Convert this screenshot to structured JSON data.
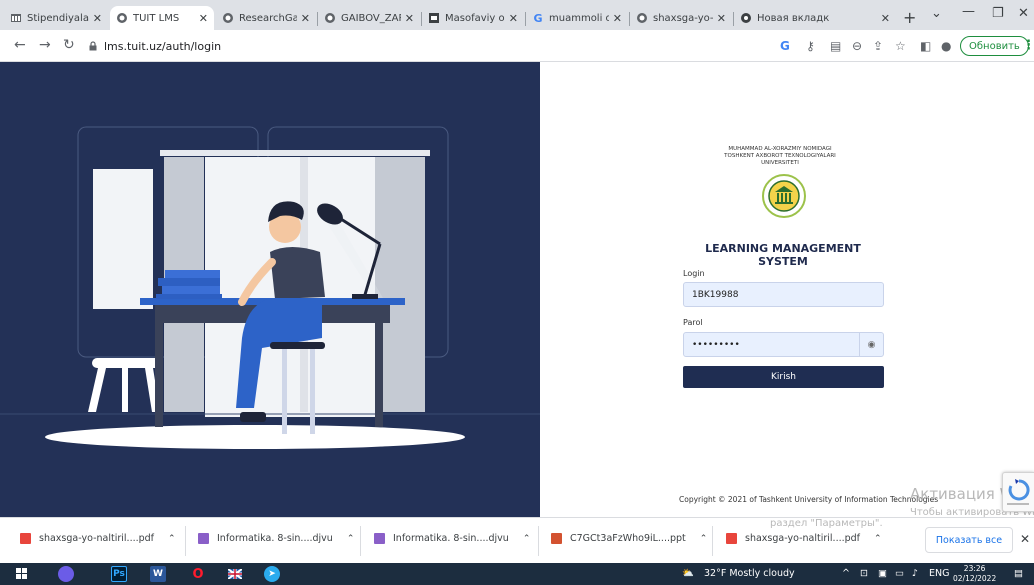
{
  "browser": {
    "tabs": [
      {
        "label": "Stipendiyalar",
        "icon": "bank-icon"
      },
      {
        "label": "TUIT LMS",
        "icon": "globe-icon"
      },
      {
        "label": "ResearchGate",
        "icon": "globe-icon"
      },
      {
        "label": "GAIBOV_ZAR",
        "icon": "globe-icon"
      },
      {
        "label": "Masofaviy o'z",
        "icon": "classroom-icon"
      },
      {
        "label": "muammoli o'",
        "icon": "google-icon"
      },
      {
        "label": "shaxsga-yo-n",
        "icon": "globe-icon"
      },
      {
        "label": "Новая вкладк",
        "icon": "chrome-icon"
      }
    ],
    "url": "lms.tuit.uz/auth/login",
    "update_label": "Обновить"
  },
  "login": {
    "university_lines": [
      "MUHAMMAD AL-XORAZMIY NOMIDAGI",
      "TOSHKENT AXBOROT TEXNOLOGIYALARI",
      "UNIVERSITETI"
    ],
    "title": "LEARNING MANAGEMENT SYSTEM",
    "login_label": "Login",
    "login_value": "1BK19988",
    "password_label": "Parol",
    "password_value": "•••••••••",
    "submit_label": "Kirish",
    "copyright": "Copyright © 2021 of Tashkent University of Information Technologies"
  },
  "watermark": {
    "line1": "Активация Windows",
    "line2": "Чтобы активировать Windows, перейдите в",
    "line3": "раздел \"Параметры\"."
  },
  "downloads": {
    "items": [
      {
        "name": "shaxsga-yo-naltiril....pdf",
        "type": "pdf",
        "color": "#e8453c"
      },
      {
        "name": "Informatika. 8-sin....djvu",
        "type": "djvu",
        "color": "#8a5fc8"
      },
      {
        "name": "Informatika. 8-sin....djvu",
        "type": "djvu",
        "color": "#8a5fc8"
      },
      {
        "name": "C7GCt3aFzWho9iL....ppt",
        "type": "ppt",
        "color": "#d35230"
      },
      {
        "name": "shaxsga-yo-naltiril....pdf",
        "type": "pdf",
        "color": "#e8453c"
      }
    ],
    "show_all": "Показать все"
  },
  "taskbar": {
    "weather": "32°F  Mostly cloudy",
    "lang": "ENG",
    "time": "23:26",
    "date": "02/12/2022",
    "apps": [
      {
        "name": "windows-start",
        "glyph": ""
      },
      {
        "name": "cortana",
        "glyph": ""
      },
      {
        "name": "photoshop",
        "glyph": "Ps"
      },
      {
        "name": "word",
        "glyph": "W"
      },
      {
        "name": "opera",
        "glyph": "O"
      },
      {
        "name": "flag",
        "glyph": ""
      },
      {
        "name": "telegram",
        "glyph": ""
      }
    ]
  }
}
